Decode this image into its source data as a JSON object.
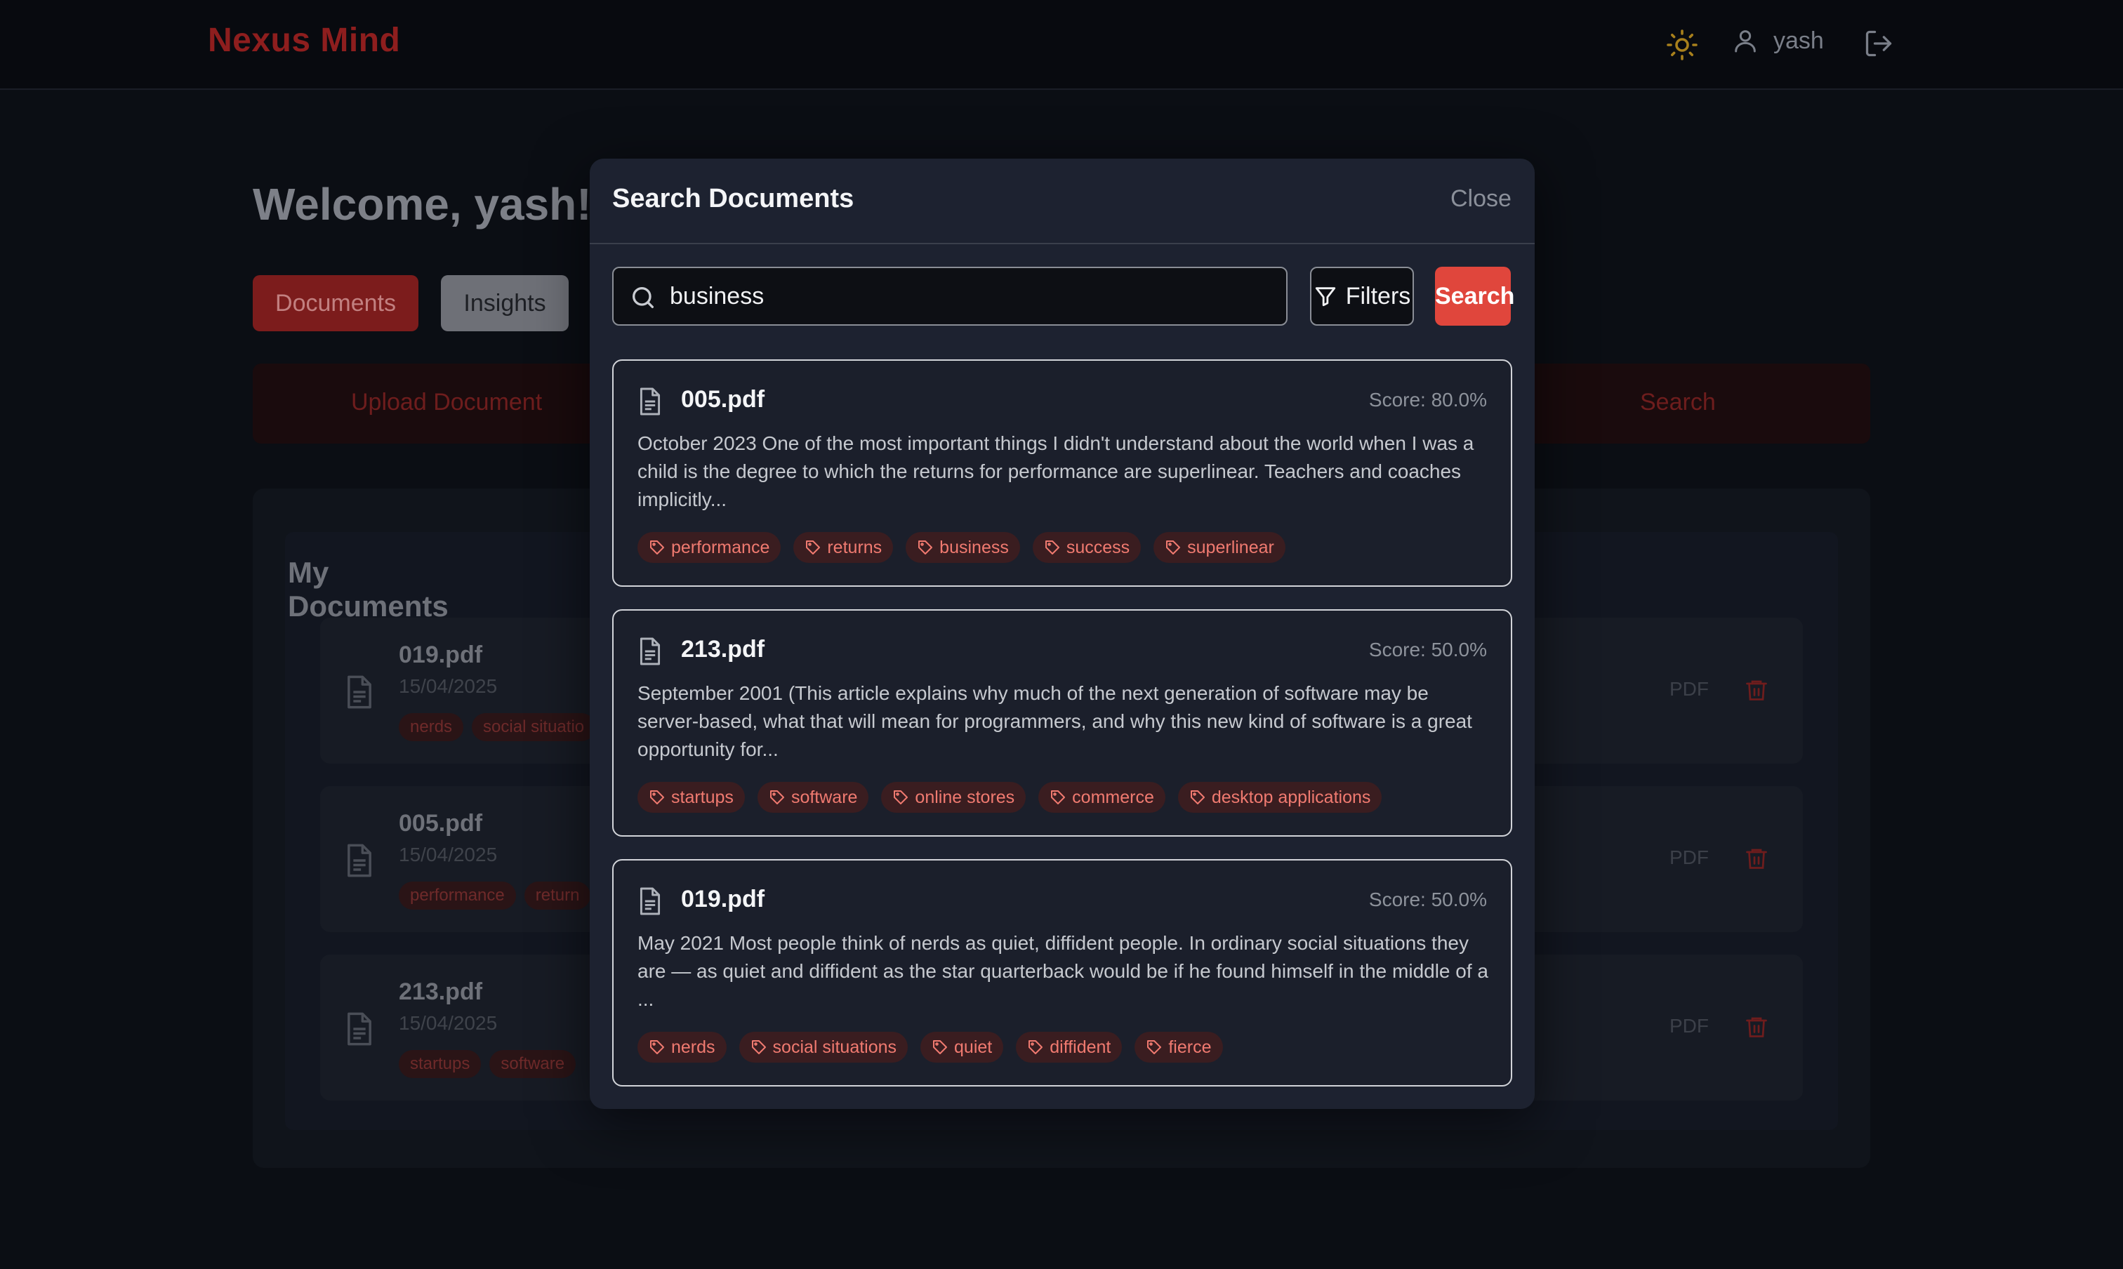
{
  "app": {
    "brand": "Nexus Mind",
    "username": "yash"
  },
  "page": {
    "welcome": "Welcome, yash!",
    "tabs": [
      {
        "label": "Documents",
        "active": true
      },
      {
        "label": "Insights",
        "active": false
      }
    ],
    "actions": {
      "upload_label": "Upload Document",
      "search_label": "Search"
    },
    "documents": {
      "title": "My Documents",
      "items": [
        {
          "name": "019.pdf",
          "date": "15/04/2025",
          "tags": [
            "nerds",
            "social situatio"
          ],
          "type": "PDF"
        },
        {
          "name": "005.pdf",
          "date": "15/04/2025",
          "tags": [
            "performance",
            "return"
          ],
          "type": "PDF"
        },
        {
          "name": "213.pdf",
          "date": "15/04/2025",
          "tags": [
            "startups",
            "software"
          ],
          "type": "PDF"
        }
      ]
    }
  },
  "modal": {
    "title": "Search Documents",
    "close_label": "Close",
    "search": {
      "value": "business",
      "placeholder": ""
    },
    "filters_label": "Filters",
    "search_button_label": "Search",
    "results": [
      {
        "name": "005.pdf",
        "score": "Score: 80.0%",
        "excerpt": "October 2023 One of the most important things I didn't understand about the world when I was a child is the degree to which the returns for performance are superlinear. Teachers and coaches implicitly...",
        "tags": [
          "performance",
          "returns",
          "business",
          "success",
          "superlinear"
        ]
      },
      {
        "name": "213.pdf",
        "score": "Score: 50.0%",
        "excerpt": "September 2001 (This article explains why much of the next generation of software may be server-based, what that will mean for programmers, and why this new kind of software is a great opportunity for...",
        "tags": [
          "startups",
          "software",
          "online stores",
          "commerce",
          "desktop applications"
        ]
      },
      {
        "name": "019.pdf",
        "score": "Score: 50.0%",
        "excerpt": "May 2021 Most people think of nerds as quiet, diffident people. In ordinary social situations they are — as quiet and diffident as the star quarterback would be if he found himself in the middle of a ...",
        "tags": [
          "nerds",
          "social situations",
          "quiet",
          "diffident",
          "fierce"
        ]
      }
    ]
  },
  "colors": {
    "brand": "#8e1e1e",
    "accent": "#e0463c",
    "tag_text": "#f07a70",
    "tag_bg": "#3a1d20"
  },
  "icons": {
    "theme": "sun-icon",
    "user": "user-icon",
    "logout": "logout-icon",
    "search": "search-icon",
    "filter": "filter-icon",
    "document": "document-icon",
    "tag": "tag-icon",
    "delete": "trash-icon"
  }
}
